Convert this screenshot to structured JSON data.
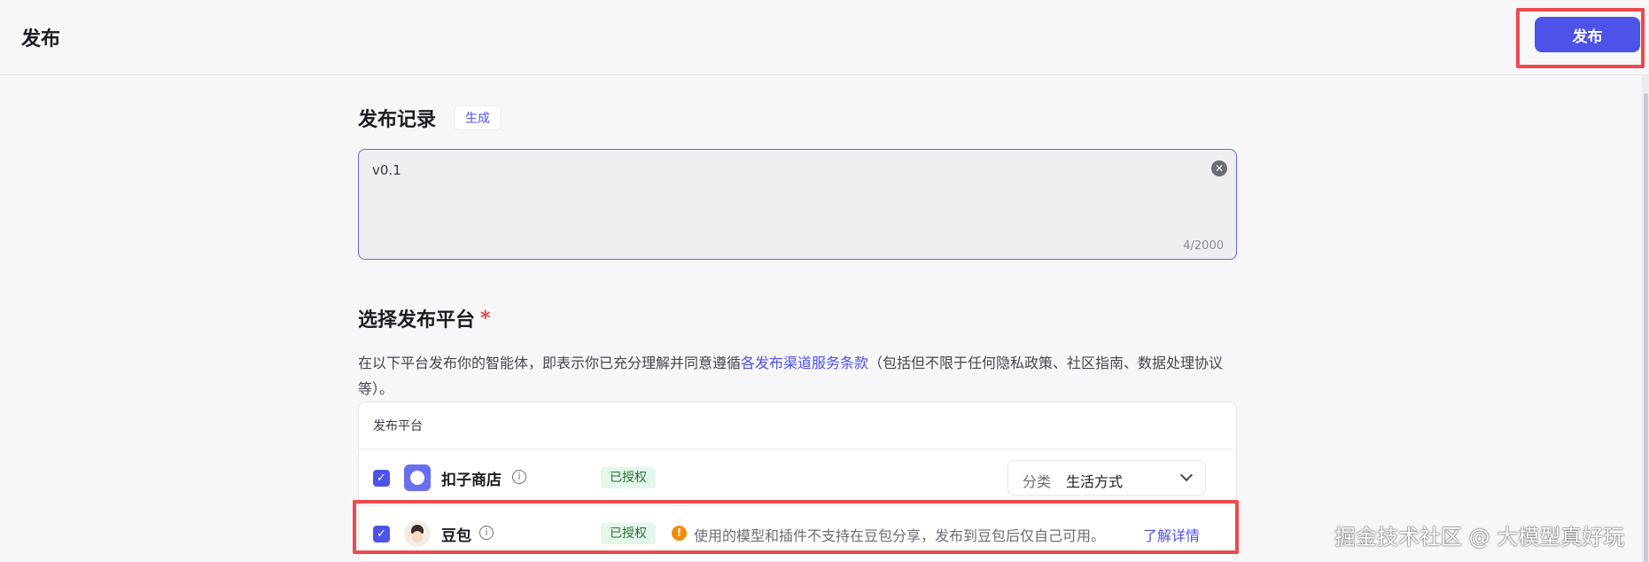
{
  "header": {
    "title": "发布",
    "publish_label": "发布"
  },
  "release_record": {
    "title": "发布记录",
    "generate_label": "生成",
    "value": "v0.1",
    "char_count": "4/2000"
  },
  "platform_section": {
    "title": "选择发布平台",
    "required_mark": "*",
    "desc_before": "在以下平台发布你的智能体，即表示你已充分理解并同意遵循",
    "desc_link": "各发布渠道服务条款",
    "desc_after": "（包括但不限于任何隐私政策、社区指南、数据处理协议等）。",
    "table_header": "发布平台",
    "rows": [
      {
        "name": "扣子商店",
        "checked": true,
        "auth_status": "已授权",
        "category_label": "分类",
        "category_value": "生活方式"
      },
      {
        "name": "豆包",
        "checked": true,
        "auth_status": "已授权",
        "warning": "使用的模型和插件不支持在豆包分享，发布到豆包后仅自己可用。",
        "detail_link": "了解详情"
      }
    ]
  },
  "watermark": "掘金技术社区 @ 大模型真好玩",
  "icons": {
    "clear": "close-circle-icon",
    "info": "info-icon",
    "warning": "warning-icon",
    "chevron": "chevron-down-icon",
    "check": "check-icon"
  },
  "colors": {
    "accent": "#4d53e8",
    "highlight": "#ec4a4e",
    "auth_bg": "#e5f6ea",
    "warning": "#f28b0d"
  }
}
